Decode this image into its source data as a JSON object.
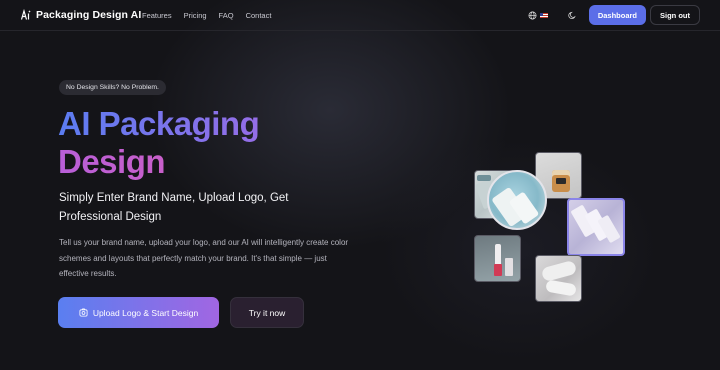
{
  "nav": {
    "brand_name": "Packaging Design AI",
    "links": [
      "Features",
      "Pricing",
      "FAQ",
      "Contact"
    ],
    "dashboard_label": "Dashboard",
    "signout_label": "Sign out",
    "language_icon": "globe-icon",
    "flag_icon": "us-flag-icon",
    "theme_icon": "moon-icon"
  },
  "hero": {
    "badge": "No Design Skills? No Problem.",
    "title_line1": "AI Packaging",
    "title_line2": "Design",
    "subtitle": "Simply Enter Brand Name, Upload Logo, Get Professional Design",
    "description": "Tell us your brand name, upload your logo, and our AI will intelligently create color schemes and layouts that perfectly match your brand. It's that simple — just effective results.",
    "primary_cta": "Upload Logo & Start Design",
    "secondary_cta": "Try it now"
  },
  "colors": {
    "accent": "#5b6ee8",
    "gradient_start": "#5a7ff0",
    "gradient_end": "#e85aa8",
    "background": "#141418"
  }
}
